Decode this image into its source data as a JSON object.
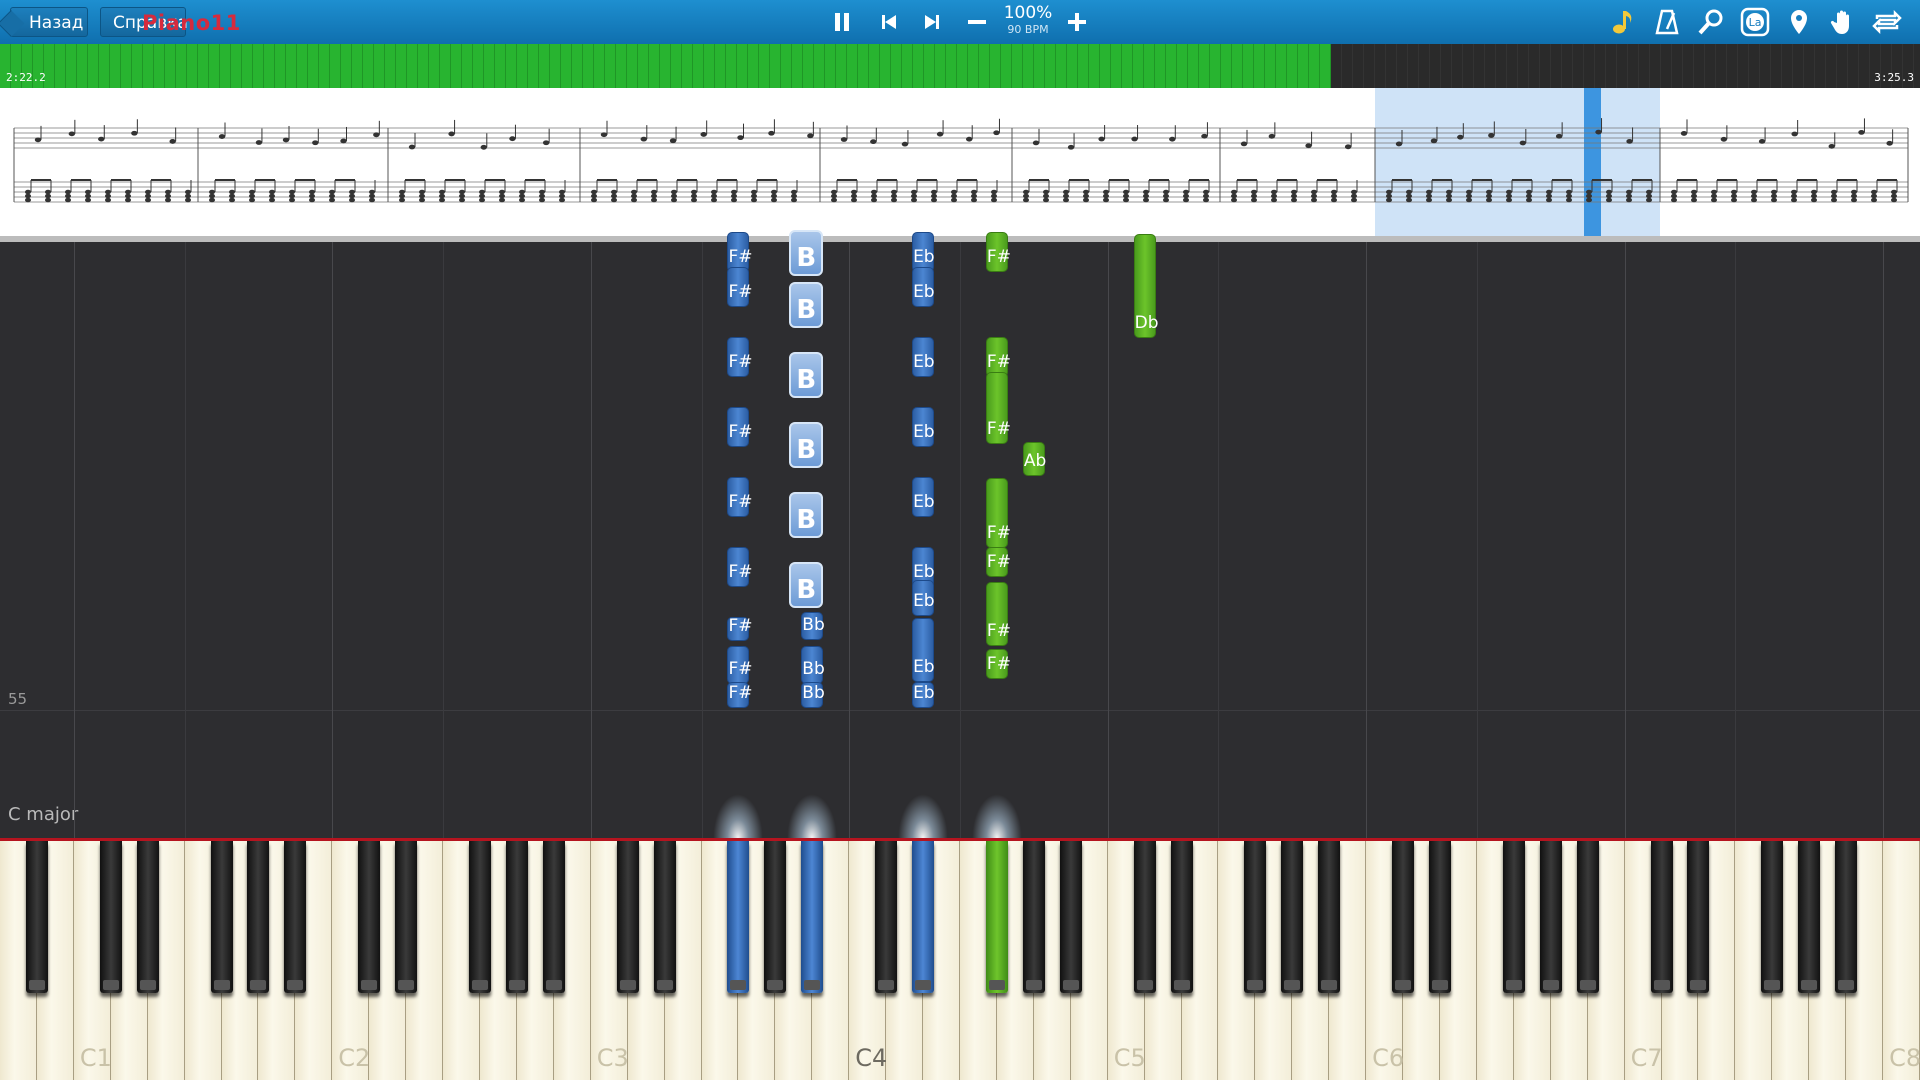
{
  "toolbar": {
    "back_label": "Назад",
    "help_label": "Справка",
    "logo_text": "Piano11",
    "zoom_percent": "100%",
    "tempo_label": "90 BPM",
    "left_icons": [
      "pause-icon",
      "skip-back-icon",
      "skip-forward-icon",
      "minus-icon",
      "plus-icon"
    ],
    "right_icons": [
      "note-icon",
      "metronome-icon",
      "magnifier-icon",
      "la-icon",
      "location-pin-icon",
      "hand-icon",
      "loop-icon"
    ],
    "la_text": "La"
  },
  "progress": {
    "elapsed": "2:22.2",
    "total": "3:25.3",
    "fraction": 0.693
  },
  "roll": {
    "measure_number": "55",
    "key_signature": "C major"
  },
  "falling_notes": [
    {
      "label": "F#",
      "color": "blue"
    },
    {
      "label": "B",
      "color": "blue-highlight"
    },
    {
      "label": "Eb",
      "color": "blue"
    },
    {
      "label": "Bb",
      "color": "blue"
    },
    {
      "label": "F#",
      "color": "green"
    },
    {
      "label": "Ab",
      "color": "green"
    },
    {
      "label": "Db",
      "color": "green"
    }
  ],
  "keyboard": {
    "octave_labels": [
      "C1",
      "C2",
      "C3",
      "C4",
      "C5",
      "C6",
      "C7",
      "C8"
    ],
    "pressed_keys": [
      {
        "note": "F#3",
        "color": "blue"
      },
      {
        "note": "Bb3",
        "color": "blue"
      },
      {
        "note": "Eb4",
        "color": "blue"
      },
      {
        "note": "F#4",
        "color": "green"
      }
    ]
  },
  "colors": {
    "left_hand": "#3f78c6",
    "right_hand": "#5fb524",
    "toolbar": "#167dbf",
    "progress": "#27b02f"
  }
}
